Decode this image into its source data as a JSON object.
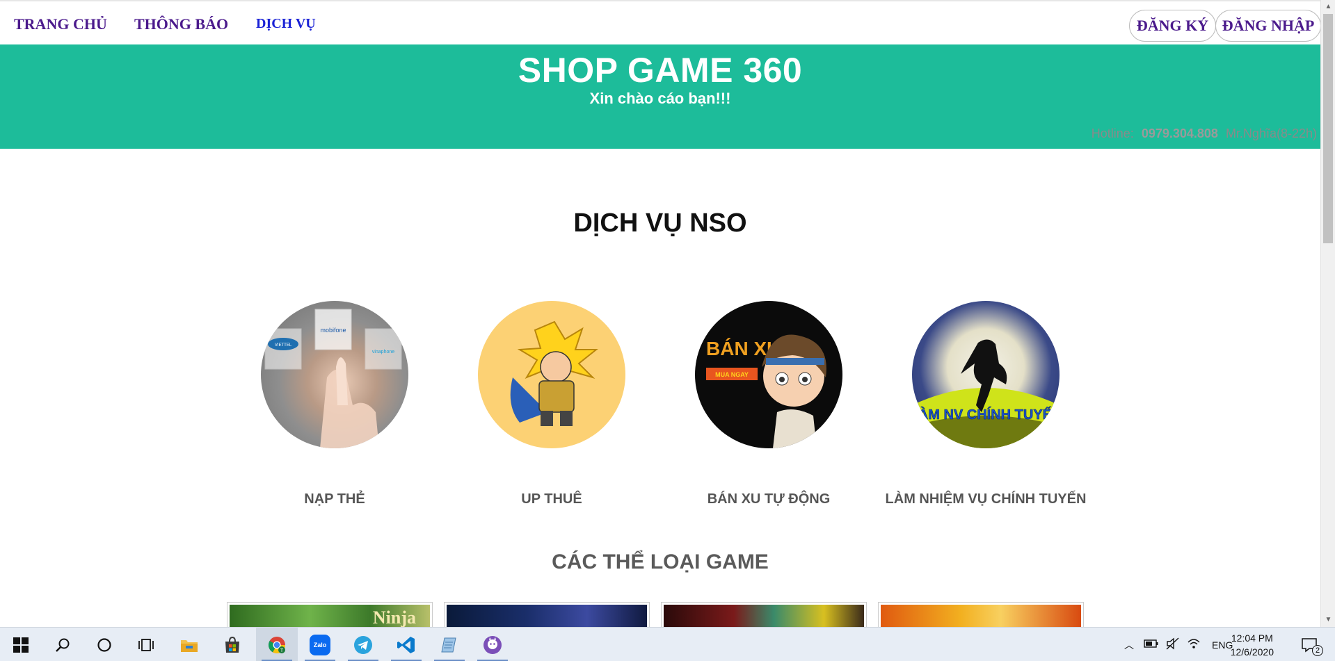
{
  "nav": {
    "links": [
      {
        "label": "TRANG CHỦ"
      },
      {
        "label": "THÔNG BÁO"
      },
      {
        "label": "DỊCH VỤ"
      }
    ],
    "register": "ĐĂNG KÝ",
    "login": "ĐĂNG NHẬP"
  },
  "banner": {
    "title": "SHOP GAME 360",
    "subtitle": "Xin chào cáo bạn!!!",
    "hotline_label": "Hotline:",
    "hotline_number": "0979.304.808",
    "hotline_contact": "Mr.Nghĩa(8-22h)"
  },
  "services": {
    "title": "DỊCH VỤ NSO",
    "items": [
      {
        "label": "NẠP THẺ",
        "icon": "card-topup-image",
        "carriers": [
          "VIETTEL",
          "mobifone",
          "vinaphone"
        ]
      },
      {
        "label": "UP THUÊ",
        "icon": "warrior-character-image"
      },
      {
        "label": "BÁN XU TỰ ĐỘNG",
        "icon": "sell-coin-image",
        "overlay_title": "BÁN XU",
        "overlay_button": "MUA NGAY"
      },
      {
        "label": "LÀM NHIỆM VỤ CHÍNH TUYẾN",
        "icon": "ninja-moon-image",
        "overlay_title": "LÀM NV CHÍNH TUYẾN"
      }
    ]
  },
  "categories": {
    "title": "CÁC THỂ LOẠI GAME",
    "thumbs": [
      {
        "icon": "ninja-game-thumbnail",
        "text": "Ninja"
      },
      {
        "icon": "dark-game-thumbnail"
      },
      {
        "icon": "red-game-thumbnail"
      },
      {
        "icon": "dragon-game-thumbnail"
      }
    ]
  },
  "taskbar": {
    "apps": [
      "windows-start-icon",
      "search-icon",
      "cortana-icon",
      "task-view-icon",
      "file-explorer-icon",
      "store-icon",
      "chrome-icon",
      "zalo-icon",
      "telegram-icon",
      "vscode-icon",
      "notepad-icon",
      "github-icon"
    ],
    "zalo_label": "Zalo",
    "lang": "ENG",
    "time": "12:04 PM",
    "date": "12/6/2020",
    "notifications": "2"
  },
  "colors": {
    "banner": "#1dbc9a",
    "nav_text": "#4b1a8c",
    "nav_active": "#1a22d6"
  }
}
